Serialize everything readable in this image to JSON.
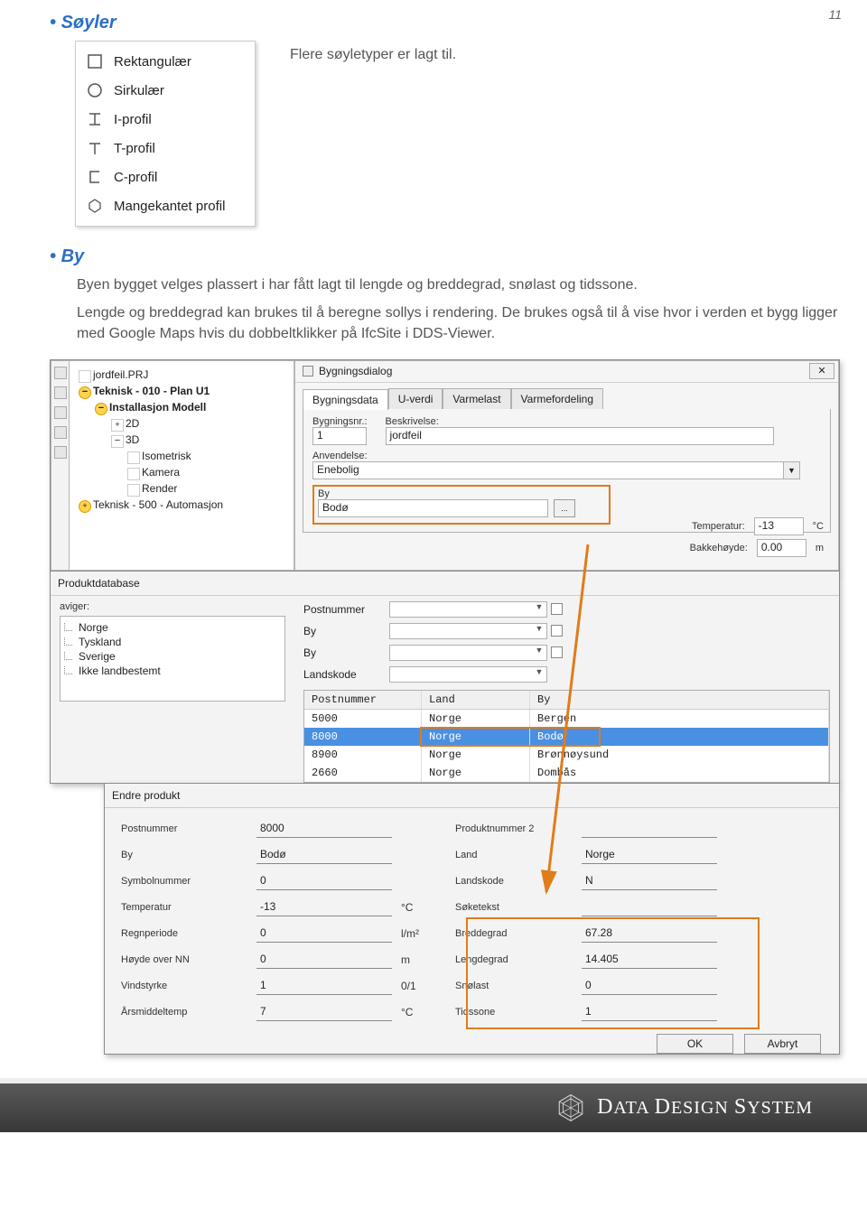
{
  "page_number": "11",
  "h_soyler": "Søyler",
  "intro_soyler": "Flere søyletyper er lagt til.",
  "profiles": {
    "items": [
      {
        "label": "Rektangulær",
        "icon": "rect-icon"
      },
      {
        "label": "Sirkulær",
        "icon": "circle-icon"
      },
      {
        "label": "I-profil",
        "icon": "i-profile-icon"
      },
      {
        "label": "T-profil",
        "icon": "t-profile-icon"
      },
      {
        "label": "C-profil",
        "icon": "c-profile-icon"
      },
      {
        "label": "Mangekantet profil",
        "icon": "polygon-icon"
      }
    ]
  },
  "h_by": "By",
  "p_by_1": "Byen bygget velges plassert i har fått lagt til lengde og breddegrad, snølast og tidssone.",
  "p_by_2": "Lengde og breddegrad kan brukes til å beregne sollys i rendering. De brukes også til å vise hvor i verden et bygg ligger med Google Maps hvis du dobbeltklikker på IfcSite i DDS-Viewer.",
  "tree": {
    "root": "jordfeil.PRJ",
    "n1": "Teknisk - 010 - Plan U1",
    "n2": "Installasjon Modell",
    "n3": "2D",
    "n4": "3D",
    "n5": "Isometrisk",
    "n6": "Kamera",
    "n7": "Render",
    "n8": "Teknisk - 500 - Automasjon"
  },
  "bygn": {
    "title": "Bygningsdialog",
    "tabs": [
      "Bygningsdata",
      "U-verdi",
      "Varmelast",
      "Varmefordeling"
    ],
    "lbl_nr": "Bygningsnr.:",
    "val_nr": "1",
    "lbl_besk": "Beskrivelse:",
    "val_besk": "jordfeil",
    "lbl_anv": "Anvendelse:",
    "val_anv": "Enebolig",
    "lbl_by": "By",
    "val_by": "Bodø",
    "lbl_temp": "Temperatur:",
    "val_temp": "-13",
    "unit_temp": "°C",
    "lbl_bak": "Bakkehøyde:",
    "val_bak": "0.00",
    "unit_bak": "m"
  },
  "prod": {
    "title": "Produktdatabase",
    "lbl_aviger": "aviger:",
    "countries": [
      "Norge",
      "Tyskland",
      "Sverige",
      "Ikke landbestemt"
    ],
    "filters": [
      "Postnummer",
      "By",
      "By",
      "Landskode"
    ],
    "table": {
      "hd": [
        "Postnummer",
        "Land",
        "By"
      ],
      "rows": [
        [
          "5000",
          "Norge",
          "Bergen"
        ],
        [
          "8000",
          "Norge",
          "Bodø"
        ],
        [
          "8900",
          "Norge",
          "Brønnøysund"
        ],
        [
          "2660",
          "Norge",
          "Dombås"
        ]
      ],
      "selected": 1
    }
  },
  "ep": {
    "title": "Endre produkt",
    "left": [
      {
        "l": "Postnummer",
        "v": "8000",
        "u": ""
      },
      {
        "l": "By",
        "v": "Bodø",
        "u": ""
      },
      {
        "l": "Symbolnummer",
        "v": "0",
        "u": ""
      },
      {
        "l": "Temperatur",
        "v": "-13",
        "u": "°C"
      },
      {
        "l": "Regnperiode",
        "v": "0",
        "u": "l/m²"
      },
      {
        "l": "Høyde over NN",
        "v": "0",
        "u": "m"
      },
      {
        "l": "Vindstyrke",
        "v": "1",
        "u": "0/1"
      },
      {
        "l": "Årsmiddeltemp",
        "v": "7",
        "u": "°C"
      }
    ],
    "right": [
      {
        "l": "Produktnummer 2",
        "v": ""
      },
      {
        "l": "Land",
        "v": "Norge"
      },
      {
        "l": "Landskode",
        "v": "N"
      },
      {
        "l": "Søketekst",
        "v": ""
      },
      {
        "l": "Breddegrad",
        "v": "67.28"
      },
      {
        "l": "Lengdegrad",
        "v": "14.405"
      },
      {
        "l": "Snølast",
        "v": "0"
      },
      {
        "l": "Tidssone",
        "v": "1"
      }
    ],
    "ok": "OK",
    "cancel": "Avbryt"
  },
  "footer": "DATA DESIGN SYSTEM"
}
